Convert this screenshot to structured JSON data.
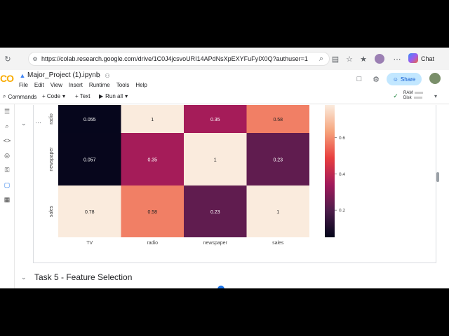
{
  "browser": {
    "url": "https://colab.research.google.com/drive/1C0J4jcsvoURI14APdNsXpEXYFuFyIX0Q?authuser=1#sc...",
    "chat_label": "Chat"
  },
  "colab": {
    "logo": "CO",
    "title": "Major_Project (1).ipynb",
    "menu": [
      "File",
      "Edit",
      "View",
      "Insert",
      "Runtime",
      "Tools",
      "Help"
    ],
    "share_label": "Share"
  },
  "toolbar": {
    "commands": "Commands",
    "code": "+ Code",
    "text": "+ Text",
    "run_all": "Run all",
    "ram": "RAM",
    "disk": "Disk"
  },
  "cell_output": {
    "chart_data": {
      "type": "heatmap",
      "row_labels": [
        "radio",
        "newspaper",
        "sales"
      ],
      "col_labels": [
        "TV",
        "radio",
        "newspaper",
        "sales"
      ],
      "values": [
        [
          0.055,
          1,
          0.35,
          0.58
        ],
        [
          0.057,
          0.35,
          1,
          0.23
        ],
        [
          0.78,
          0.58,
          0.23,
          1
        ]
      ],
      "value_labels": [
        [
          "0.055",
          "1",
          "0.35",
          "0.58"
        ],
        [
          "0.057",
          "0.35",
          "1",
          "0.23"
        ],
        [
          "0.78",
          "0.58",
          "0.23",
          "1"
        ]
      ],
      "colorbar_ticks": [
        "0.6",
        "0.4",
        "0.2"
      ],
      "colorbar_tick_values": [
        0.6,
        0.4,
        0.2
      ],
      "colorbar_range": [
        0.05,
        0.78
      ],
      "colormap": "rocket",
      "colorbar_colors": [
        "#faebdd",
        "#f6a47c",
        "#e83f3f",
        "#a11a5b",
        "#4c1d4b",
        "#03051a"
      ]
    }
  },
  "next_section": {
    "title": "Task 5 - Feature Selection"
  }
}
